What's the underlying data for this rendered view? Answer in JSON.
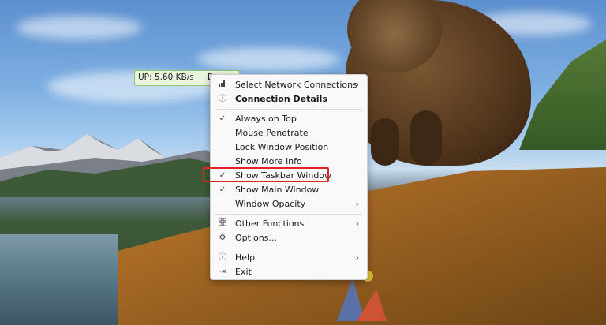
{
  "network_widget": {
    "upload": "UP: 5.60 KB/s",
    "download_prefix": "D"
  },
  "menu": {
    "items": [
      {
        "label": "Select Network Connections",
        "icon": "network-bars-icon",
        "checked": false,
        "submenu": true,
        "bold": false
      },
      {
        "label": "Connection Details",
        "icon": "info-icon",
        "checked": false,
        "submenu": false,
        "bold": true
      },
      {
        "label": "Always on Top",
        "icon": "check-icon",
        "checked": true,
        "submenu": false,
        "bold": false
      },
      {
        "label": "Mouse Penetrate",
        "icon": "",
        "checked": false,
        "submenu": false,
        "bold": false
      },
      {
        "label": "Lock Window Position",
        "icon": "",
        "checked": false,
        "submenu": false,
        "bold": false
      },
      {
        "label": "Show More Info",
        "icon": "",
        "checked": false,
        "submenu": false,
        "bold": false
      },
      {
        "label": "Show Taskbar Window",
        "icon": "check-icon",
        "checked": true,
        "submenu": false,
        "bold": false,
        "highlighted": true
      },
      {
        "label": "Show Main Window",
        "icon": "check-icon",
        "checked": true,
        "submenu": false,
        "bold": false
      },
      {
        "label": "Window Opacity",
        "icon": "",
        "checked": false,
        "submenu": true,
        "bold": false
      },
      {
        "label": "Other Functions",
        "icon": "grid-icon",
        "checked": false,
        "submenu": true,
        "bold": false
      },
      {
        "label": "Options...",
        "icon": "gear-icon",
        "checked": false,
        "submenu": false,
        "bold": false
      },
      {
        "label": "Help",
        "icon": "help-icon",
        "checked": false,
        "submenu": true,
        "bold": false
      },
      {
        "label": "Exit",
        "icon": "exit-icon",
        "checked": false,
        "submenu": false,
        "bold": false
      }
    ]
  },
  "colors": {
    "highlight_box": "#e02424",
    "widget_border": "#8fc46b"
  }
}
